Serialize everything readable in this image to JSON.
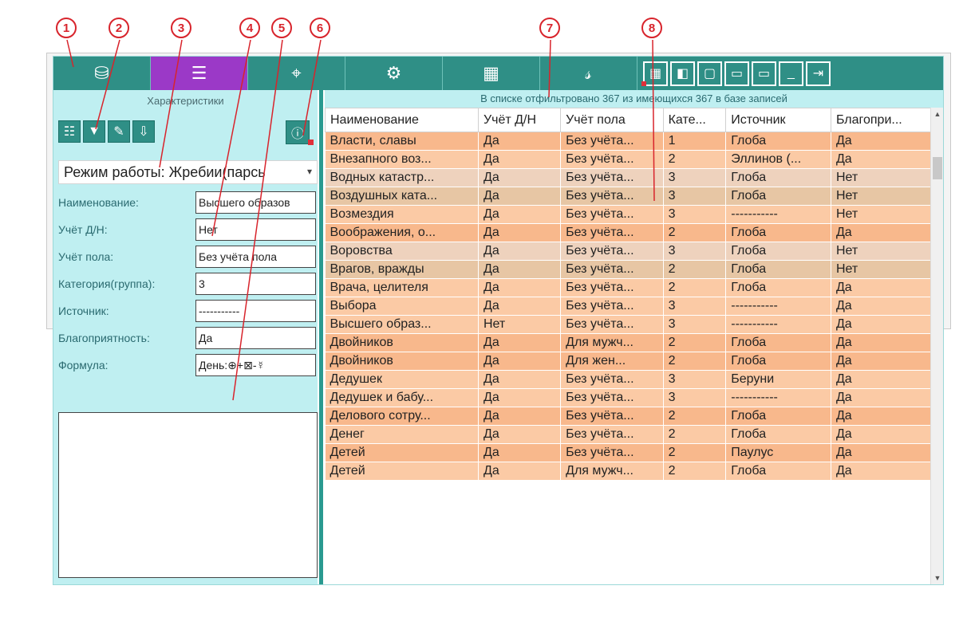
{
  "toolbar": {
    "buttons": [
      {
        "icon": "database-icon",
        "glyph": "⛁",
        "active": false
      },
      {
        "icon": "list-icon",
        "glyph": "☰",
        "active": true
      },
      {
        "icon": "crosshair-icon",
        "glyph": "⌖",
        "active": false
      },
      {
        "icon": "gear-icon",
        "glyph": "⚙",
        "active": false
      },
      {
        "icon": "calculator-icon",
        "glyph": "▦",
        "active": false
      },
      {
        "icon": "script-icon",
        "glyph": "𝓈",
        "active": false
      }
    ],
    "window_buttons": [
      {
        "icon": "grid-view-icon",
        "glyph": "▦"
      },
      {
        "icon": "layout-left-icon",
        "glyph": "◧"
      },
      {
        "icon": "layout-full-icon",
        "glyph": "▢"
      },
      {
        "icon": "layout-bottom-icon",
        "glyph": "▭"
      },
      {
        "icon": "layout-top-icon",
        "glyph": "▭"
      },
      {
        "icon": "minimize-icon",
        "glyph": "_"
      },
      {
        "icon": "exit-icon",
        "glyph": "⇥"
      }
    ]
  },
  "left": {
    "title": "Характеристики",
    "tool_icons": [
      {
        "name": "table-view-icon",
        "glyph": "☷"
      },
      {
        "name": "filter-icon",
        "glyph": "▼"
      },
      {
        "name": "edit-icon",
        "glyph": "✎"
      },
      {
        "name": "export-icon",
        "glyph": "⇩"
      }
    ],
    "info_icon": "ⓘ",
    "mode": "Режим работы: Жребии(парсь",
    "fields": [
      {
        "label": "Наименование:",
        "value": "Высшего образов"
      },
      {
        "label": "Учёт Д/Н:",
        "value": "Нет"
      },
      {
        "label": "Учёт пола:",
        "value": "Без учёта пола"
      },
      {
        "label": "Категория(группа):",
        "value": "3"
      },
      {
        "label": "Источник:",
        "value": "-----------"
      },
      {
        "label": "Благоприятность:",
        "value": "Да"
      },
      {
        "label": "Формула:",
        "value": "День:⊕+⊠-☿"
      }
    ]
  },
  "right": {
    "title": "В списке отфильтровано 367 из имеющихся 367 в базе записей",
    "columns": [
      "Наименование",
      "Учёт Д/Н",
      "Учёт пола",
      "Кате...",
      "Источник",
      "Благопри..."
    ],
    "rows": [
      [
        "Власти, славы",
        "Да",
        "Без учёта...",
        "1",
        "Глоба",
        "Да"
      ],
      [
        "Внезапного воз...",
        "Да",
        "Без учёта...",
        "2",
        "Эллинов (...",
        "Да"
      ],
      [
        "Водных катастр...",
        "Да",
        "Без учёта...",
        "3",
        "Глоба",
        "Нет"
      ],
      [
        "Воздушных ката...",
        "Да",
        "Без учёта...",
        "3",
        "Глоба",
        "Нет"
      ],
      [
        "Возмездия",
        "Да",
        "Без учёта...",
        "3",
        "-----------",
        "Нет"
      ],
      [
        "Воображения, о...",
        "Да",
        "Без учёта...",
        "2",
        "Глоба",
        "Да"
      ],
      [
        "Воровства",
        "Да",
        "Без учёта...",
        "3",
        "Глоба",
        "Нет"
      ],
      [
        "Врагов, вражды",
        "Да",
        "Без учёта...",
        "2",
        "Глоба",
        "Нет"
      ],
      [
        "Врача, целителя",
        "Да",
        "Без учёта...",
        "2",
        "Глоба",
        "Да"
      ],
      [
        "Выбора",
        "Да",
        "Без учёта...",
        "3",
        "-----------",
        "Да"
      ],
      [
        "Высшего образ...",
        "Нет",
        "Без учёта...",
        "3",
        "-----------",
        "Да"
      ],
      [
        "Двойников",
        "Да",
        "Для мужч...",
        "2",
        "Глоба",
        "Да"
      ],
      [
        "Двойников",
        "Да",
        "Для жен...",
        "2",
        "Глоба",
        "Да"
      ],
      [
        "Дедушек",
        "Да",
        "Без учёта...",
        "3",
        "Беруни",
        "Да"
      ],
      [
        "Дедушек и бабу...",
        "Да",
        "Без учёта...",
        "3",
        "-----------",
        "Да"
      ],
      [
        "Делового сотру...",
        "Да",
        "Без учёта...",
        "2",
        "Глоба",
        "Да"
      ],
      [
        "Денег",
        "Да",
        "Без учёта...",
        "2",
        "Глоба",
        "Да"
      ],
      [
        "Детей",
        "Да",
        "Без учёта...",
        "2",
        "Паулус",
        "Да"
      ],
      [
        "Детей",
        "Да",
        "Для мужч...",
        "2",
        "Глоба",
        "Да"
      ]
    ],
    "row_styles": [
      "r0",
      "r1",
      "r2",
      "r3",
      "r1",
      "r0",
      "r2",
      "r3",
      "r1",
      "r1",
      "r1",
      "r0",
      "r0",
      "r1",
      "r1",
      "r0",
      "r1",
      "r0",
      "r1"
    ]
  },
  "callouts": [
    "1",
    "2",
    "3",
    "4",
    "5",
    "6",
    "7",
    "8"
  ],
  "colors": {
    "accent": "#2f8f86",
    "active": "#9b39c7",
    "panel": "#bfeff1",
    "callout": "#d8242c"
  }
}
